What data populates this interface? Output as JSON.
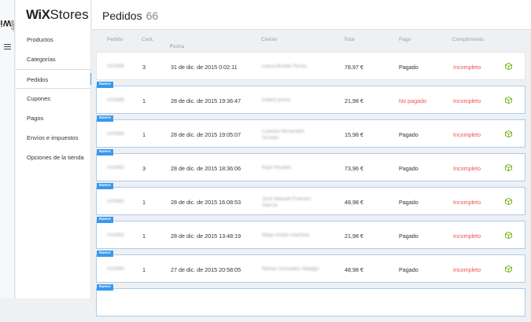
{
  "rail": {
    "logo_main": "WiX",
    "logo_small": ".com"
  },
  "sidebar": {
    "brand_bold": "WiX",
    "brand_rest": "Stores",
    "items": [
      {
        "label": "Productos"
      },
      {
        "label": "Categorías"
      },
      {
        "label": "Pedidos"
      },
      {
        "label": "Cupones"
      },
      {
        "label": "Pagos"
      },
      {
        "label": "Envíos e impuestos"
      },
      {
        "label": "Opciones de la tienda"
      }
    ]
  },
  "header": {
    "title": "Pedidos",
    "count": "66"
  },
  "columns": {
    "pedido": "Pedido",
    "cant": "Cant.",
    "fecha": "Fecha",
    "fecha_caret": "▾",
    "cliente": "Cliente",
    "total": "Total",
    "pago": "Pago",
    "cumplimiento": "Cumplimiento"
  },
  "badge_label": "Nuevo",
  "status_colors": {
    "incompleto": "#ef5350",
    "no_pagado": "#ef5350",
    "accent": "#3899ec",
    "box_icon": "#7cb518"
  },
  "orders": [
    {
      "nuevo": false,
      "pedido": "#10088",
      "cant": "3",
      "fecha": "31 de dic. de 2015 0:02:11",
      "cliente": "Laura Bruela Torres",
      "cliente2": "",
      "total": "78,97 €",
      "pago": "Pagado",
      "cumplimiento": "Incompleto"
    },
    {
      "nuevo": true,
      "pedido": "#10085",
      "cant": "1",
      "fecha": "28 de dic. de 2015 19:36:47",
      "cliente": "Imbert perez",
      "cliente2": "",
      "total": "21,98 €",
      "pago": "No pagado",
      "cumplimiento": "Incompleto"
    },
    {
      "nuevo": true,
      "pedido": "#10084",
      "cant": "1",
      "fecha": "28 de dic. de 2015 19:05:07",
      "cliente": "Lorenzo fernandez",
      "cliente2": "Arnedo",
      "total": "15,98 €",
      "pago": "Pagado",
      "cumplimiento": "Incompleto"
    },
    {
      "nuevo": true,
      "pedido": "#10083",
      "cant": "3",
      "fecha": "28 de dic. de 2015 18:36:06",
      "cliente": "Raúl Perales",
      "cliente2": "",
      "total": "73,96 €",
      "pago": "Pagado",
      "cumplimiento": "Incompleto"
    },
    {
      "nuevo": true,
      "pedido": "#10082",
      "cant": "1",
      "fecha": "28 de dic. de 2015 16:08:53",
      "cliente": "José Manuel Fuentes",
      "cliente2": "García",
      "total": "48,98 €",
      "pago": "Pagado",
      "cumplimiento": "Incompleto"
    },
    {
      "nuevo": true,
      "pedido": "#10081",
      "cant": "1",
      "fecha": "28 de dic. de 2015 13:48:19",
      "cliente": "Mayo tirado martínez",
      "cliente2": "",
      "total": "21,98 €",
      "pago": "Pagado",
      "cumplimiento": "Incompleto"
    },
    {
      "nuevo": true,
      "pedido": "#10080",
      "cant": "1",
      "fecha": "27 de dic. de 2015 20:58:05",
      "cliente": "Renee González Hidalgo",
      "cliente2": "",
      "total": "48,98 €",
      "pago": "Pagado",
      "cumplimiento": "Incompleto"
    },
    {
      "nuevo": true,
      "pedido": "",
      "cant": "",
      "fecha": "",
      "cliente": "",
      "cliente2": "",
      "total": "",
      "pago": "",
      "cumplimiento": ""
    }
  ]
}
